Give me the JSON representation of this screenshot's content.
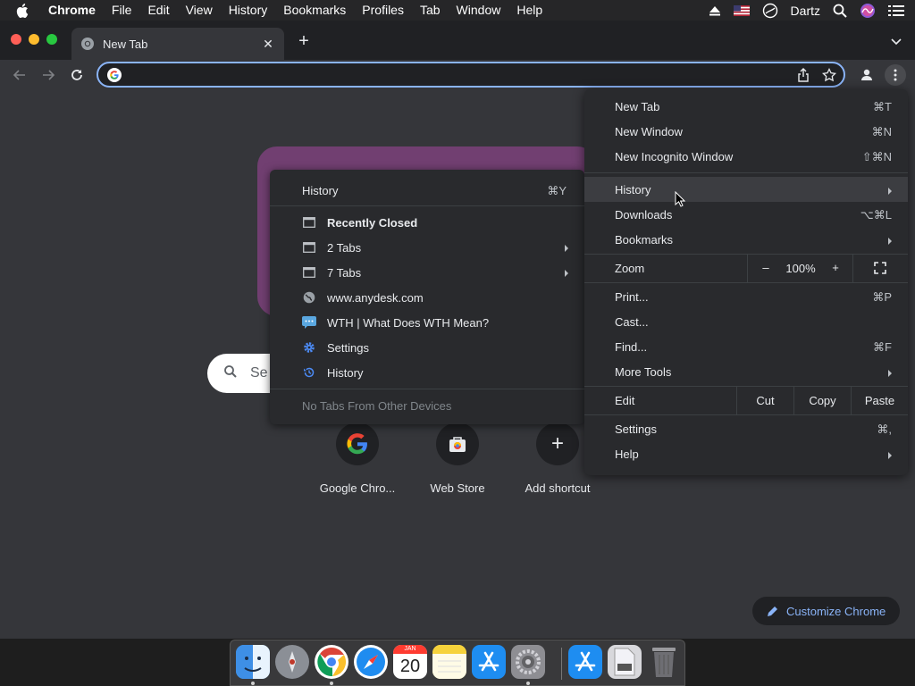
{
  "menubar": {
    "app": "Chrome",
    "items": [
      "File",
      "Edit",
      "View",
      "History",
      "Bookmarks",
      "Profiles",
      "Tab",
      "Window",
      "Help"
    ],
    "user": "Dartz"
  },
  "tab": {
    "title": "New Tab",
    "close": "✕",
    "new_tab": "+"
  },
  "omnibox": {
    "value": ""
  },
  "ntp": {
    "search_placeholder": "Se",
    "shortcuts": [
      "Google Chro...",
      "Web Store",
      "Add shortcut"
    ],
    "add_symbol": "+",
    "customize": "Customize Chrome"
  },
  "history_submenu": {
    "title": "History",
    "title_key": "⌘Y",
    "recently_closed": "Recently Closed",
    "items": [
      "2 Tabs",
      "7 Tabs",
      "www.anydesk.com",
      "WTH | What Does WTH Mean?",
      "Settings",
      "History"
    ],
    "no_other_devices": "No Tabs From Other Devices"
  },
  "main_menu": {
    "new_tab": {
      "label": "New Tab",
      "key": "⌘T"
    },
    "new_window": {
      "label": "New Window",
      "key": "⌘N"
    },
    "new_incognito": {
      "label": "New Incognito Window",
      "key": "⇧⌘N"
    },
    "history": {
      "label": "History"
    },
    "downloads": {
      "label": "Downloads",
      "key": "⌥⌘L"
    },
    "bookmarks": {
      "label": "Bookmarks"
    },
    "zoom": {
      "label": "Zoom",
      "minus": "–",
      "value": "100%",
      "plus": "+"
    },
    "print": {
      "label": "Print...",
      "key": "⌘P"
    },
    "cast": {
      "label": "Cast..."
    },
    "find": {
      "label": "Find...",
      "key": "⌘F"
    },
    "more_tools": {
      "label": "More Tools"
    },
    "edit": {
      "label": "Edit",
      "cut": "Cut",
      "copy": "Copy",
      "paste": "Paste"
    },
    "settings": {
      "label": "Settings",
      "key": "⌘,"
    },
    "help": {
      "label": "Help"
    }
  },
  "dock": {
    "calendar_month": "JAN",
    "calendar_day": "20"
  },
  "colors": {
    "accent": "#8ab4f8",
    "menu_bg": "#292a2d",
    "page_bg": "#35363a",
    "doodle": "#a3479f"
  }
}
